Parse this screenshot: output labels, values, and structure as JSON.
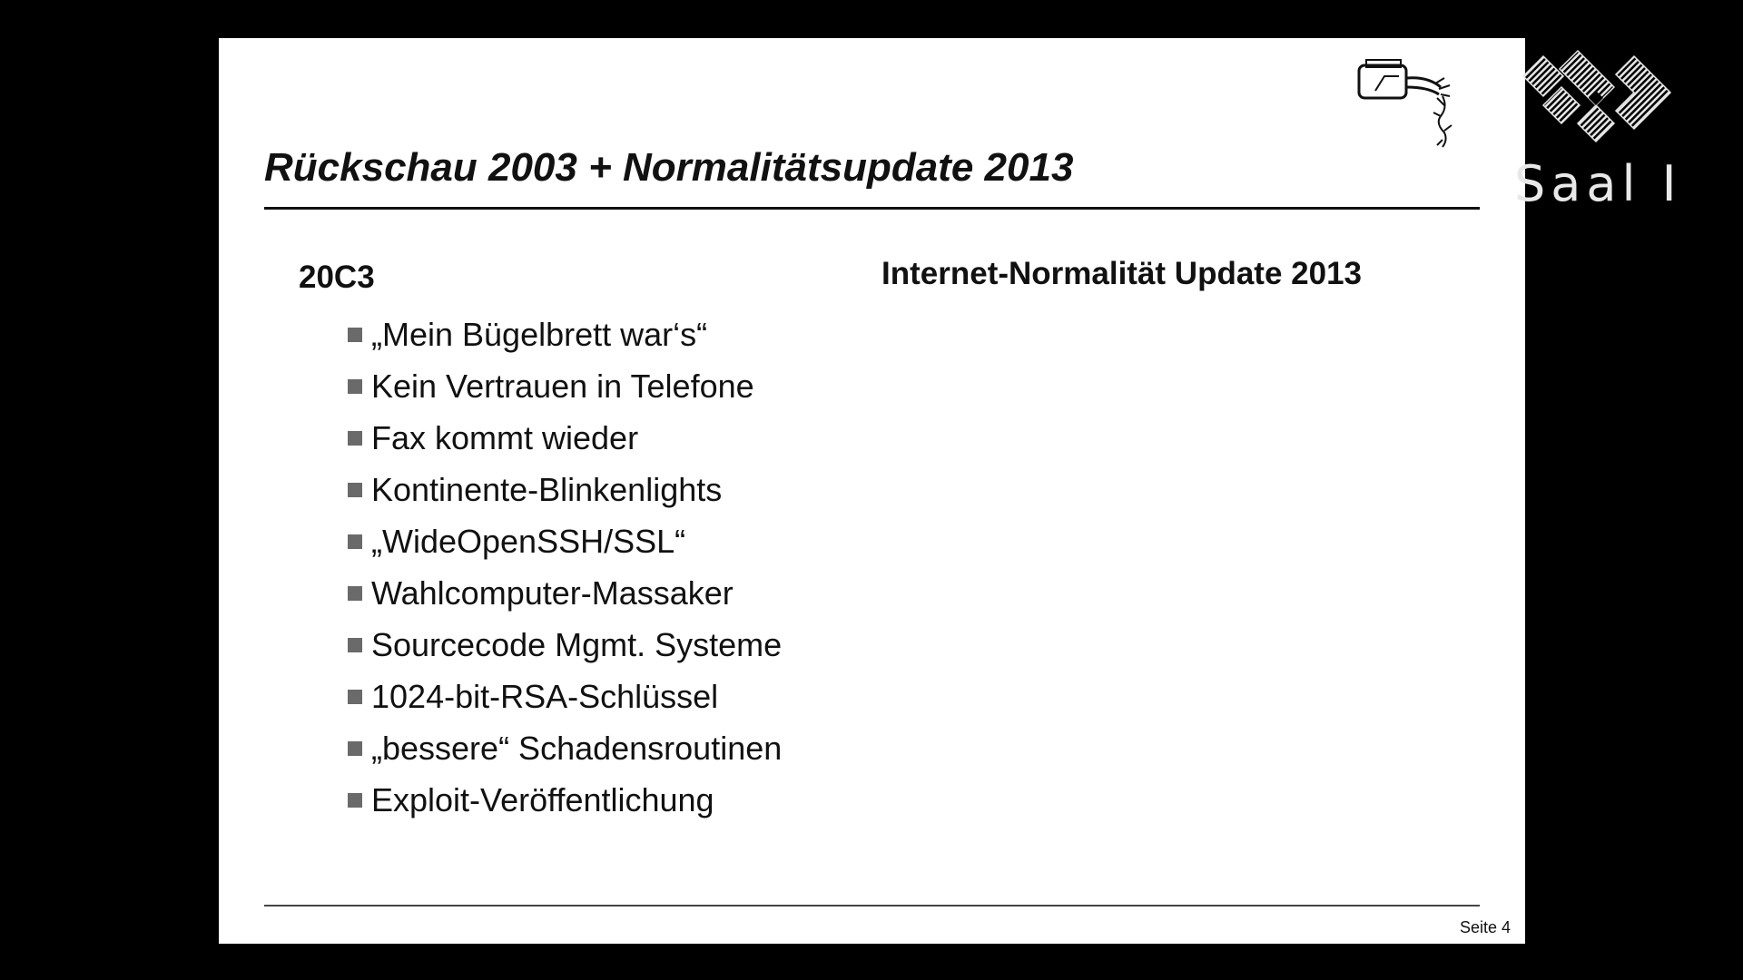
{
  "overlay": {
    "room_label": "Saal I",
    "logo_icon": "congress-logo-icon"
  },
  "slide": {
    "title": "Rückschau 2003 + Normalitätsupdate 2013",
    "logo_icon": "hand-keyboard-logo-icon",
    "left_column": {
      "heading": "20C3",
      "items": [
        "„Mein Bügelbrett war‘s“",
        "Kein Vertrauen in Telefone",
        "Fax kommt wieder",
        "Kontinente-Blinkenlights",
        "„WideOpenSSH/SSL“",
        "Wahlcomputer-Massaker",
        "Sourcecode Mgmt. Systeme",
        "1024-bit-RSA-Schlüssel",
        "„bessere“ Schadensroutinen",
        "Exploit-Veröffentlichung"
      ]
    },
    "right_column": {
      "heading": "Internet-Normalität Update 2013"
    },
    "page_number": "Seite 4"
  },
  "colors": {
    "background": "#000000",
    "slide": "#ffffff",
    "text": "#111111",
    "bullet": "#6a6a6a"
  }
}
